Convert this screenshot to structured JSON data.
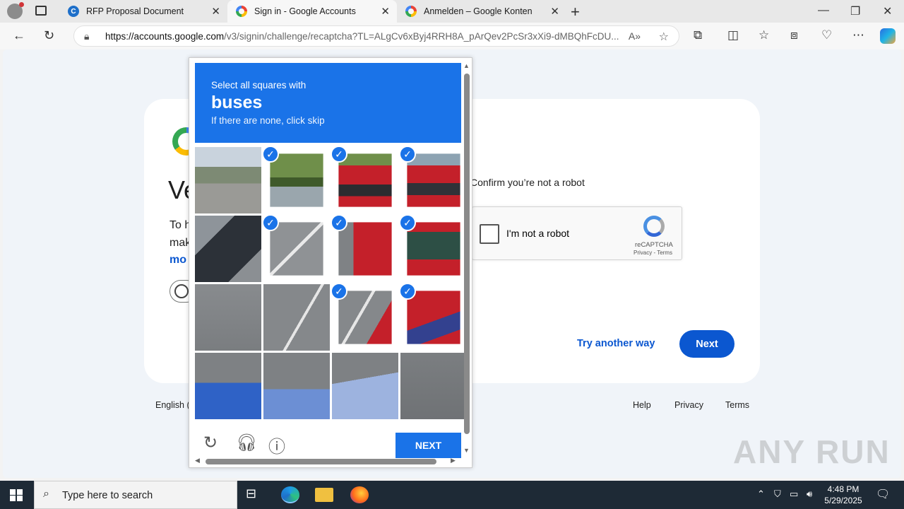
{
  "browser": {
    "tabs": [
      {
        "title": "RFP Proposal Document",
        "favicon": "canva-icon"
      },
      {
        "title": "Sign in - Google Accounts",
        "favicon": "google-icon",
        "active": true
      },
      {
        "title": "Anmelden – Google Konten",
        "favicon": "google-icon"
      }
    ],
    "url_host": "https://accounts.google.com",
    "url_path": "/v3/signin/challenge/recaptcha?TL=ALgCv6xByj4RRH8A_pArQev2PcSr3xXi9-dMBQhFcDU..."
  },
  "page": {
    "title_partial": "Ve",
    "para_line1": "To h",
    "para_line2": "mak",
    "para_link": "mo",
    "confirm_text": "Confirm you’re not a robot",
    "recaptcha_label": "I'm not a robot",
    "recaptcha_brand": "reCAPTCHA",
    "recaptcha_links": "Privacy - Terms",
    "try_another_way": "Try another way",
    "next": "Next",
    "language_partial": "English (",
    "footer": {
      "help": "Help",
      "privacy": "Privacy",
      "terms": "Terms"
    }
  },
  "challenge": {
    "instruction": "Select all squares with",
    "target": "buses",
    "hint": "If there are none, click skip",
    "next_label": "NEXT",
    "selected_tiles": [
      1,
      2,
      3,
      5,
      6,
      7,
      10,
      11
    ],
    "tile_count": 16
  },
  "watermark": "ANY RUN",
  "taskbar": {
    "search_placeholder": "Type here to search",
    "time": "4:48 PM",
    "date": "5/29/2025"
  },
  "colors": {
    "google_blue": "#0b57d0",
    "recaptcha_blue": "#1a73e8",
    "taskbar": "#1e2a36"
  }
}
